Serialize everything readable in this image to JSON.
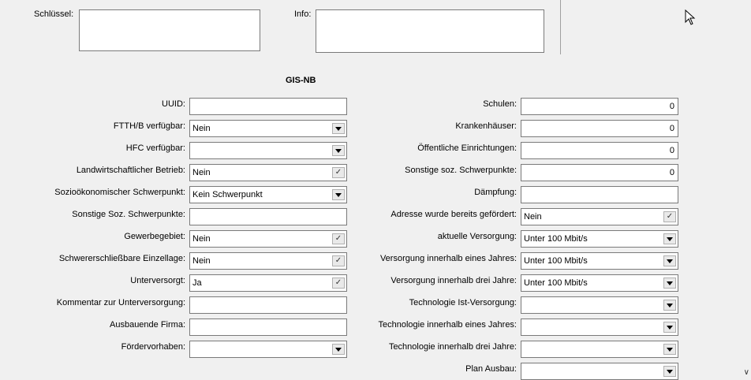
{
  "top": {
    "schluessel_label": "Schlüssel:",
    "schluessel_value": "",
    "info_label": "Info:",
    "info_value": ""
  },
  "section_title": "GIS-NB",
  "left_fields": [
    {
      "label": "UUID:",
      "value": "",
      "kind": "text"
    },
    {
      "label": "FTTH/B verfügbar:",
      "value": "Nein",
      "kind": "dropdown"
    },
    {
      "label": "HFC verfügbar:",
      "value": "",
      "kind": "dropdown"
    },
    {
      "label": "Landwirtschaftlicher Betrieb:",
      "value": "Nein",
      "kind": "check"
    },
    {
      "label": "Sozioökonomischer Schwerpunkt:",
      "value": "Kein Schwerpunkt",
      "kind": "dropdown"
    },
    {
      "label": "Sonstige Soz. Schwerpunkte:",
      "value": "",
      "kind": "text"
    },
    {
      "label": "Gewerbegebiet:",
      "value": "Nein",
      "kind": "check"
    },
    {
      "label": "Schwererschließbare Einzellage:",
      "value": "Nein",
      "kind": "check"
    },
    {
      "label": "Unterversorgt:",
      "value": "Ja",
      "kind": "check"
    },
    {
      "label": "Kommentar zur Unterversorgung:",
      "value": "",
      "kind": "text"
    },
    {
      "label": "Ausbauende Firma:",
      "value": "",
      "kind": "text"
    },
    {
      "label": "Fördervorhaben:",
      "value": "",
      "kind": "dropdown"
    }
  ],
  "right_fields": [
    {
      "label": "Schulen:",
      "value": "0",
      "kind": "number"
    },
    {
      "label": "Krankenhäuser:",
      "value": "0",
      "kind": "number"
    },
    {
      "label": "Öffentliche Einrichtungen:",
      "value": "0",
      "kind": "number"
    },
    {
      "label": "Sonstige soz. Schwerpunkte:",
      "value": "0",
      "kind": "number"
    },
    {
      "label": "Dämpfung:",
      "value": "",
      "kind": "text"
    },
    {
      "label": "Adresse wurde bereits gefördert:",
      "value": "Nein",
      "kind": "check"
    },
    {
      "label": "aktuelle Versorgung:",
      "value": "Unter 100 Mbit/s",
      "kind": "dropdown"
    },
    {
      "label": "Versorgung innerhalb eines Jahres:",
      "value": "Unter 100 Mbit/s",
      "kind": "dropdown"
    },
    {
      "label": "Versorgung innerhalb drei Jahre:",
      "value": "Unter 100 Mbit/s",
      "kind": "dropdown"
    },
    {
      "label": "Technologie Ist-Versorgung:",
      "value": "",
      "kind": "dropdown"
    },
    {
      "label": "Technologie innerhalb eines Jahres:",
      "value": "",
      "kind": "dropdown"
    },
    {
      "label": "Technologie innerhalb drei Jahre:",
      "value": "",
      "kind": "dropdown"
    },
    {
      "label": "Plan Ausbau:",
      "value": "",
      "kind": "dropdown"
    }
  ],
  "icons": {
    "dropdown": "chevron-down-icon",
    "check": "checkmark-icon",
    "cursor": "mouse-pointer-icon",
    "scroll": "scroll-down-arrow-icon"
  }
}
